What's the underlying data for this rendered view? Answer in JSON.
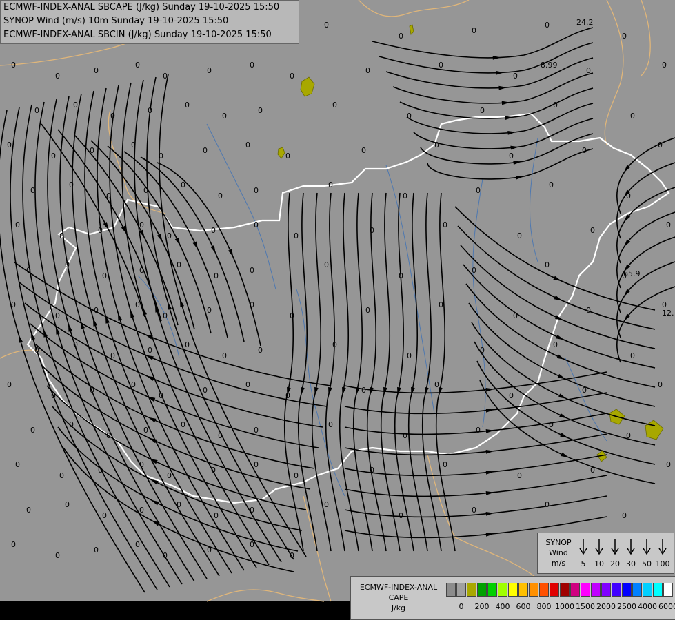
{
  "title_lines": [
    "ECMWF-INDEX-ANAL SBCAPE (J/kg) Sunday 19-10-2025 15:50",
    "SYNOP Wind (m/s) 10m Sunday 19-10-2025 15:50",
    "ECMWF-INDEX-ANAL SBCIN (J/kg) Sunday 19-10-2025 15:50"
  ],
  "colors": {
    "background": "#969696",
    "streamline": "#000000",
    "border": "#ffffff",
    "neighbor_border": "#e0b67a",
    "river": "#4e78b0",
    "cape_patch": "#a8a800"
  },
  "labeled_values": [
    "24.2",
    "8.99",
    "65.9",
    "12.",
    "0"
  ],
  "wind_legend": {
    "title_lines": [
      "SYNOP",
      "Wind",
      "m/s"
    ],
    "values": [
      "5",
      "10",
      "20",
      "30",
      "50",
      "100"
    ]
  },
  "cape_legend": {
    "title_lines": [
      "ECMWF-INDEX-ANAL",
      "CAPE",
      "J/kg"
    ],
    "colors": [
      "#8c8c8c",
      "#a0a0a0",
      "#a8a800",
      "#00a000",
      "#00d000",
      "#a0ff00",
      "#ffff00",
      "#ffc000",
      "#ff9000",
      "#ff5000",
      "#e00000",
      "#a00000",
      "#d00080",
      "#ff00ff",
      "#c000ff",
      "#8000ff",
      "#4000ff",
      "#0000ff",
      "#0080ff",
      "#00d0ff",
      "#00ffff",
      "#ffffff"
    ],
    "ticks": [
      "0",
      "200",
      "400",
      "600",
      "800",
      "1000",
      "1500",
      "2000",
      "2500",
      "4000",
      "6000"
    ]
  }
}
